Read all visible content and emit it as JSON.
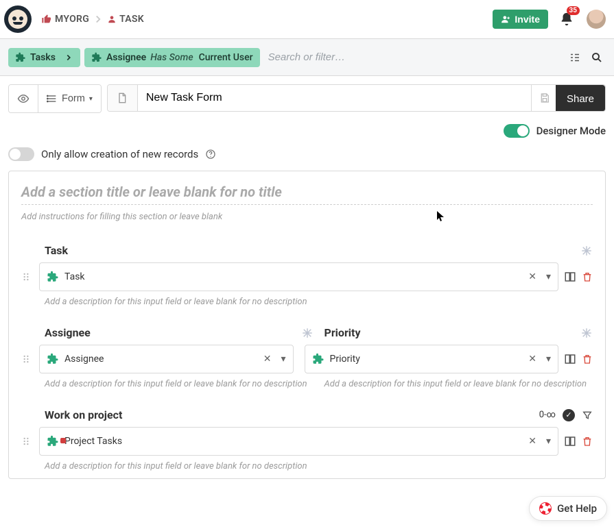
{
  "header": {
    "breadcrumb": {
      "org": "MYORG",
      "entity": "TASK"
    },
    "invite_label": "Invite",
    "notification_count": "35"
  },
  "filterbar": {
    "entity_pill": "Tasks",
    "filter_field": "Assignee",
    "filter_op": "Has Some",
    "filter_value": "Current User",
    "search_placeholder": "Search or filter…"
  },
  "titlebar": {
    "view_label": "Form",
    "form_name": "New Task Form",
    "share_label": "Share"
  },
  "designer": {
    "toggle_label": "Designer Mode",
    "toggle_on": true
  },
  "allow_creation": {
    "label": "Only allow creation of new records",
    "on": false
  },
  "section": {
    "title_placeholder": "Add a section title or leave blank for no title",
    "instructions_placeholder": "Add instructions for filling this section or leave blank"
  },
  "fields": {
    "desc_placeholder": "Add a description for this input field or leave blank for no description",
    "row1": {
      "a": {
        "label": "Task",
        "value": "Task"
      }
    },
    "row2": {
      "a": {
        "label": "Assignee",
        "value": "Assignee"
      },
      "b": {
        "label": "Priority",
        "value": "Priority"
      }
    },
    "row3": {
      "a": {
        "label": "Work on project",
        "value": "Project Tasks",
        "count": "0-∞"
      }
    }
  },
  "help": {
    "label": "Get Help"
  }
}
